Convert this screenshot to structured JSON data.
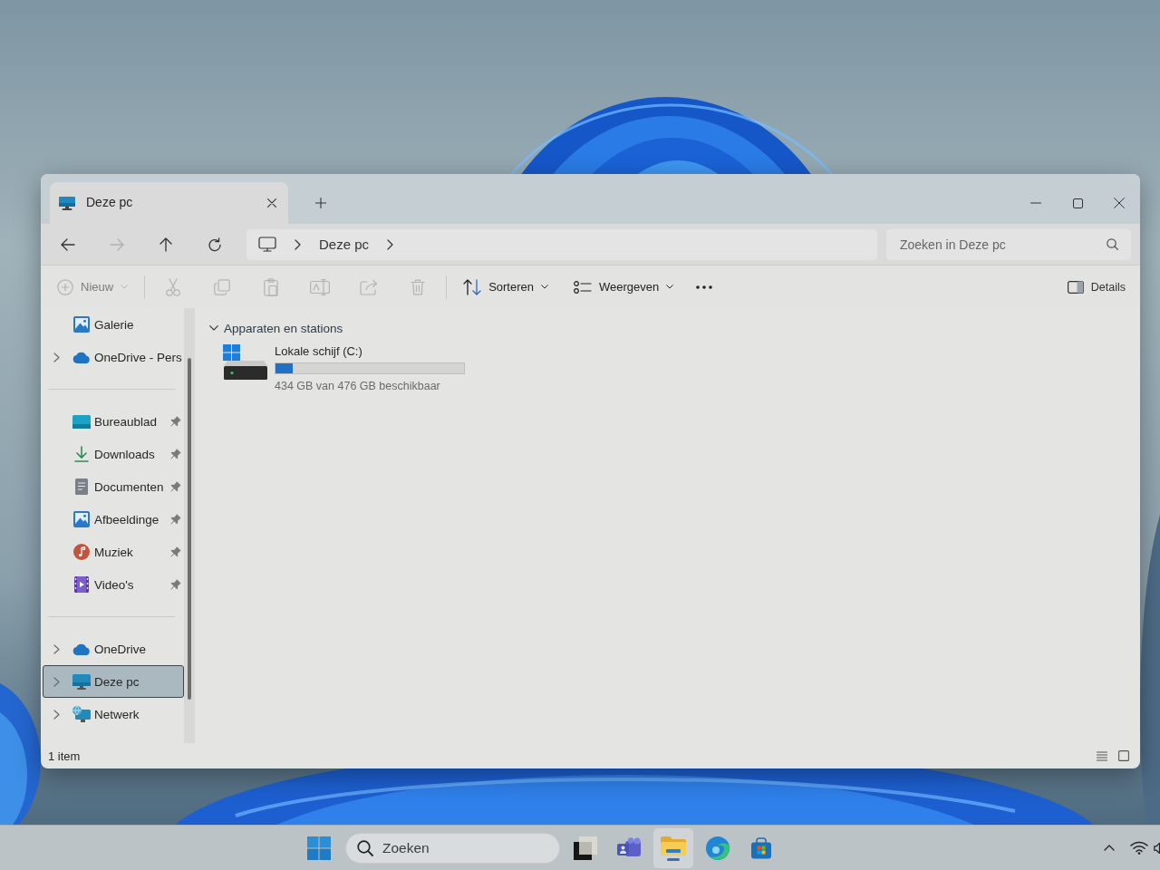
{
  "window": {
    "tabs": [
      {
        "title": "Deze pc",
        "selected": true
      }
    ]
  },
  "navigation": [
    {
      "kind": "back",
      "disabled": false
    },
    {
      "kind": "forward",
      "disabled": true
    },
    {
      "kind": "up",
      "disabled": false
    },
    {
      "kind": "refresh",
      "disabled": false
    }
  ],
  "address": {
    "segments": [
      "Deze pc"
    ]
  },
  "search": {
    "placeholder": "Zoeken in Deze pc"
  },
  "toolbar": {
    "items": [
      {
        "kind": "new",
        "label": "Nieuw",
        "dropdown": true,
        "disabled": true
      },
      {
        "kind": "separator"
      },
      {
        "kind": "cut",
        "disabled": true
      },
      {
        "kind": "copy",
        "disabled": true
      },
      {
        "kind": "paste",
        "disabled": true
      },
      {
        "kind": "rename",
        "disabled": true
      },
      {
        "kind": "share",
        "disabled": true
      },
      {
        "kind": "delete",
        "disabled": true
      },
      {
        "kind": "separator"
      },
      {
        "kind": "sort",
        "label": "Sorteren",
        "dropdown": true,
        "disabled": false
      },
      {
        "kind": "view",
        "label": "Weergeven",
        "dropdown": true,
        "disabled": false
      },
      {
        "kind": "more",
        "disabled": false
      }
    ],
    "details": {
      "label": "Details"
    }
  },
  "sidebar": {
    "sections": [
      {
        "items": [
          {
            "kind": "gallery",
            "label": "Galerie",
            "expandable": false,
            "pinned": false,
            "selected": false
          },
          {
            "kind": "cloud",
            "label": "OneDrive - Pers",
            "expandable": true,
            "pinned": false,
            "selected": false
          }
        ]
      },
      {
        "items": [
          {
            "kind": "desktop",
            "label": "Bureaublad",
            "expandable": false,
            "pinned": true,
            "selected": false
          },
          {
            "kind": "download",
            "label": "Downloads",
            "expandable": false,
            "pinned": true,
            "selected": false
          },
          {
            "kind": "document",
            "label": "Documenten",
            "expandable": false,
            "pinned": true,
            "selected": false
          },
          {
            "kind": "pictures",
            "label": "Afbeeldinge",
            "expandable": false,
            "pinned": true,
            "selected": false
          },
          {
            "kind": "music",
            "label": "Muziek",
            "expandable": false,
            "pinned": true,
            "selected": false
          },
          {
            "kind": "video",
            "label": "Video's",
            "expandable": false,
            "pinned": true,
            "selected": false
          }
        ]
      },
      {
        "items": [
          {
            "kind": "cloud",
            "label": "OneDrive",
            "expandable": true,
            "pinned": false,
            "selected": false
          },
          {
            "kind": "pc",
            "label": "Deze pc",
            "expandable": true,
            "pinned": false,
            "selected": true
          },
          {
            "kind": "network",
            "label": "Netwerk",
            "expandable": true,
            "pinned": false,
            "selected": false
          }
        ]
      }
    ]
  },
  "content": {
    "sections": [
      {
        "title": "Apparaten en stations",
        "expanded": true,
        "drives": [
          {
            "name": "Lokale schijf (C:)",
            "level": 0.09,
            "reading": "434 GB van 476 GB beschikbaar"
          }
        ]
      }
    ]
  },
  "status_bar": {
    "text": "1 item"
  },
  "taskbar": {
    "search": {
      "placeholder": "Zoeken"
    },
    "apps": [
      {
        "kind": "squares",
        "active": false
      },
      {
        "kind": "chat",
        "active": false
      },
      {
        "kind": "folder",
        "active": true
      },
      {
        "kind": "browser",
        "active": false
      },
      {
        "kind": "store",
        "active": false
      }
    ]
  }
}
